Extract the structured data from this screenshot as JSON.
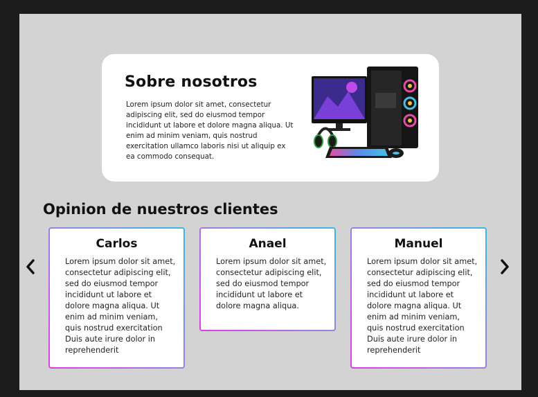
{
  "about": {
    "title": "Sobre nosotros",
    "text": "Lorem ipsum dolor sit amet, consectetur adipiscing elit, sed do eiusmod tempor incididunt ut labore et dolore magna aliqua. Ut enim ad minim veniam, quis nostrud exercitation ullamco laboris nisi ut aliquip ex ea commodo consequat.",
    "image_icon": "gaming-pc-icon"
  },
  "testimonials": {
    "title": "Opinion de nuestros clientes",
    "prev_icon": "chevron-left-icon",
    "next_icon": "chevron-right-icon",
    "cards": [
      {
        "name": "Carlos",
        "text": "Lorem ipsum dolor sit amet, consectetur adipiscing elit, sed do eiusmod tempor incididunt ut labore et dolore magna aliqua. Ut enim ad minim veniam, quis nostrud exercitation Duis aute irure dolor in reprehenderit"
      },
      {
        "name": "Anael",
        "text": "Lorem ipsum dolor sit amet, consectetur adipiscing elit, sed do eiusmod tempor incididunt ut labore et dolore magna aliqua."
      },
      {
        "name": "Manuel",
        "text": "Lorem ipsum dolor sit amet, consectetur adipiscing elit, sed do eiusmod tempor incididunt ut labore et dolore magna aliqua. Ut enim ad minim veniam, quis nostrud exercitation Duis aute irure dolor in reprehenderit"
      }
    ]
  },
  "colors": {
    "background": "#1c1c1c",
    "canvas": "#d3d3d3",
    "card_border_start": "#e23bea",
    "card_border_end": "#3ab8e6"
  }
}
